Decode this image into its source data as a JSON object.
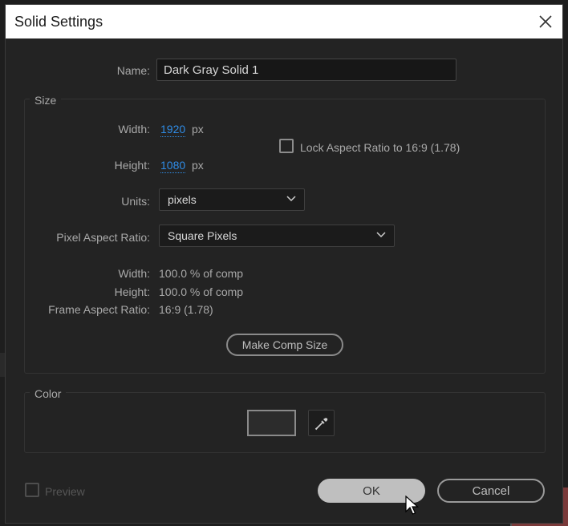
{
  "dialog": {
    "title": "Solid Settings",
    "close_icon": "close-icon"
  },
  "name": {
    "label": "Name:",
    "value": "Dark Gray Solid 1"
  },
  "size": {
    "group_title": "Size",
    "width_label": "Width:",
    "width_value": "1920",
    "width_unit": "px",
    "height_label": "Height:",
    "height_value": "1080",
    "height_unit": "px",
    "lock_aspect_label": "Lock Aspect Ratio to 16:9 (1.78)",
    "lock_aspect_checked": false,
    "units_label": "Units:",
    "units_value": "pixels",
    "par_label": "Pixel Aspect Ratio:",
    "par_value": "Square Pixels",
    "info_width_label": "Width:",
    "info_width_value": "100.0 % of comp",
    "info_height_label": "Height:",
    "info_height_value": "100.0 % of comp",
    "frame_aspect_label": "Frame Aspect Ratio:",
    "frame_aspect_value": "16:9 (1.78)",
    "make_comp_size_label": "Make Comp Size"
  },
  "color": {
    "group_title": "Color",
    "swatch_hex": "#2c2c2c",
    "eyedropper_icon": "eyedropper-icon"
  },
  "footer": {
    "preview_label": "Preview",
    "preview_checked": false,
    "ok_label": "OK",
    "cancel_label": "Cancel"
  },
  "colors": {
    "accent_blue": "#2f8ce6",
    "ok_fill": "#bfbfbf",
    "dialog_bg": "#232323"
  }
}
